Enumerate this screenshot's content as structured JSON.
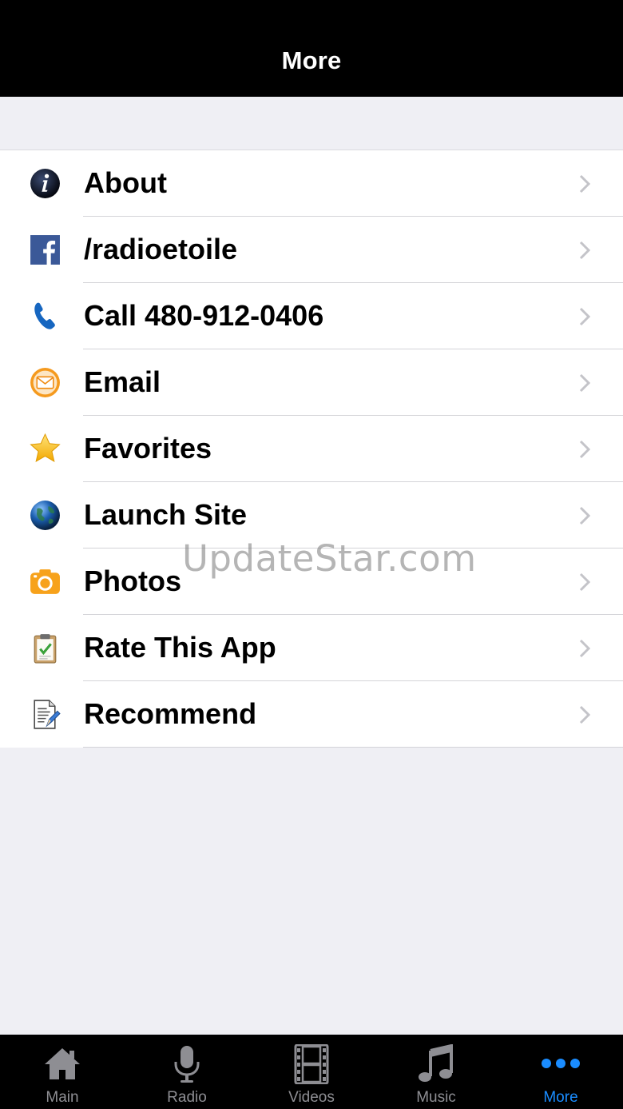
{
  "header": {
    "title": "More"
  },
  "menu": {
    "items": [
      {
        "label": "About",
        "icon": "info-icon"
      },
      {
        "label": "/radioetoile",
        "icon": "facebook-icon"
      },
      {
        "label": "Call 480-912-0406",
        "icon": "phone-icon"
      },
      {
        "label": "Email",
        "icon": "email-icon"
      },
      {
        "label": "Favorites",
        "icon": "star-icon"
      },
      {
        "label": "Launch Site",
        "icon": "globe-icon"
      },
      {
        "label": "Photos",
        "icon": "camera-icon"
      },
      {
        "label": "Rate This App",
        "icon": "clipboard-check-icon"
      },
      {
        "label": "Recommend",
        "icon": "document-edit-icon"
      }
    ]
  },
  "watermark": "UpdateStar.com",
  "tabbar": {
    "tabs": [
      {
        "label": "Main",
        "icon": "home-icon"
      },
      {
        "label": "Radio",
        "icon": "microphone-icon"
      },
      {
        "label": "Videos",
        "icon": "film-icon"
      },
      {
        "label": "Music",
        "icon": "music-note-icon"
      },
      {
        "label": "More",
        "icon": "more-dots-icon",
        "active": true
      }
    ]
  },
  "colors": {
    "active_tab": "#1a8cff",
    "inactive_tab": "#8e8e93",
    "bar_background": "#000000",
    "page_background": "#efeff4"
  }
}
